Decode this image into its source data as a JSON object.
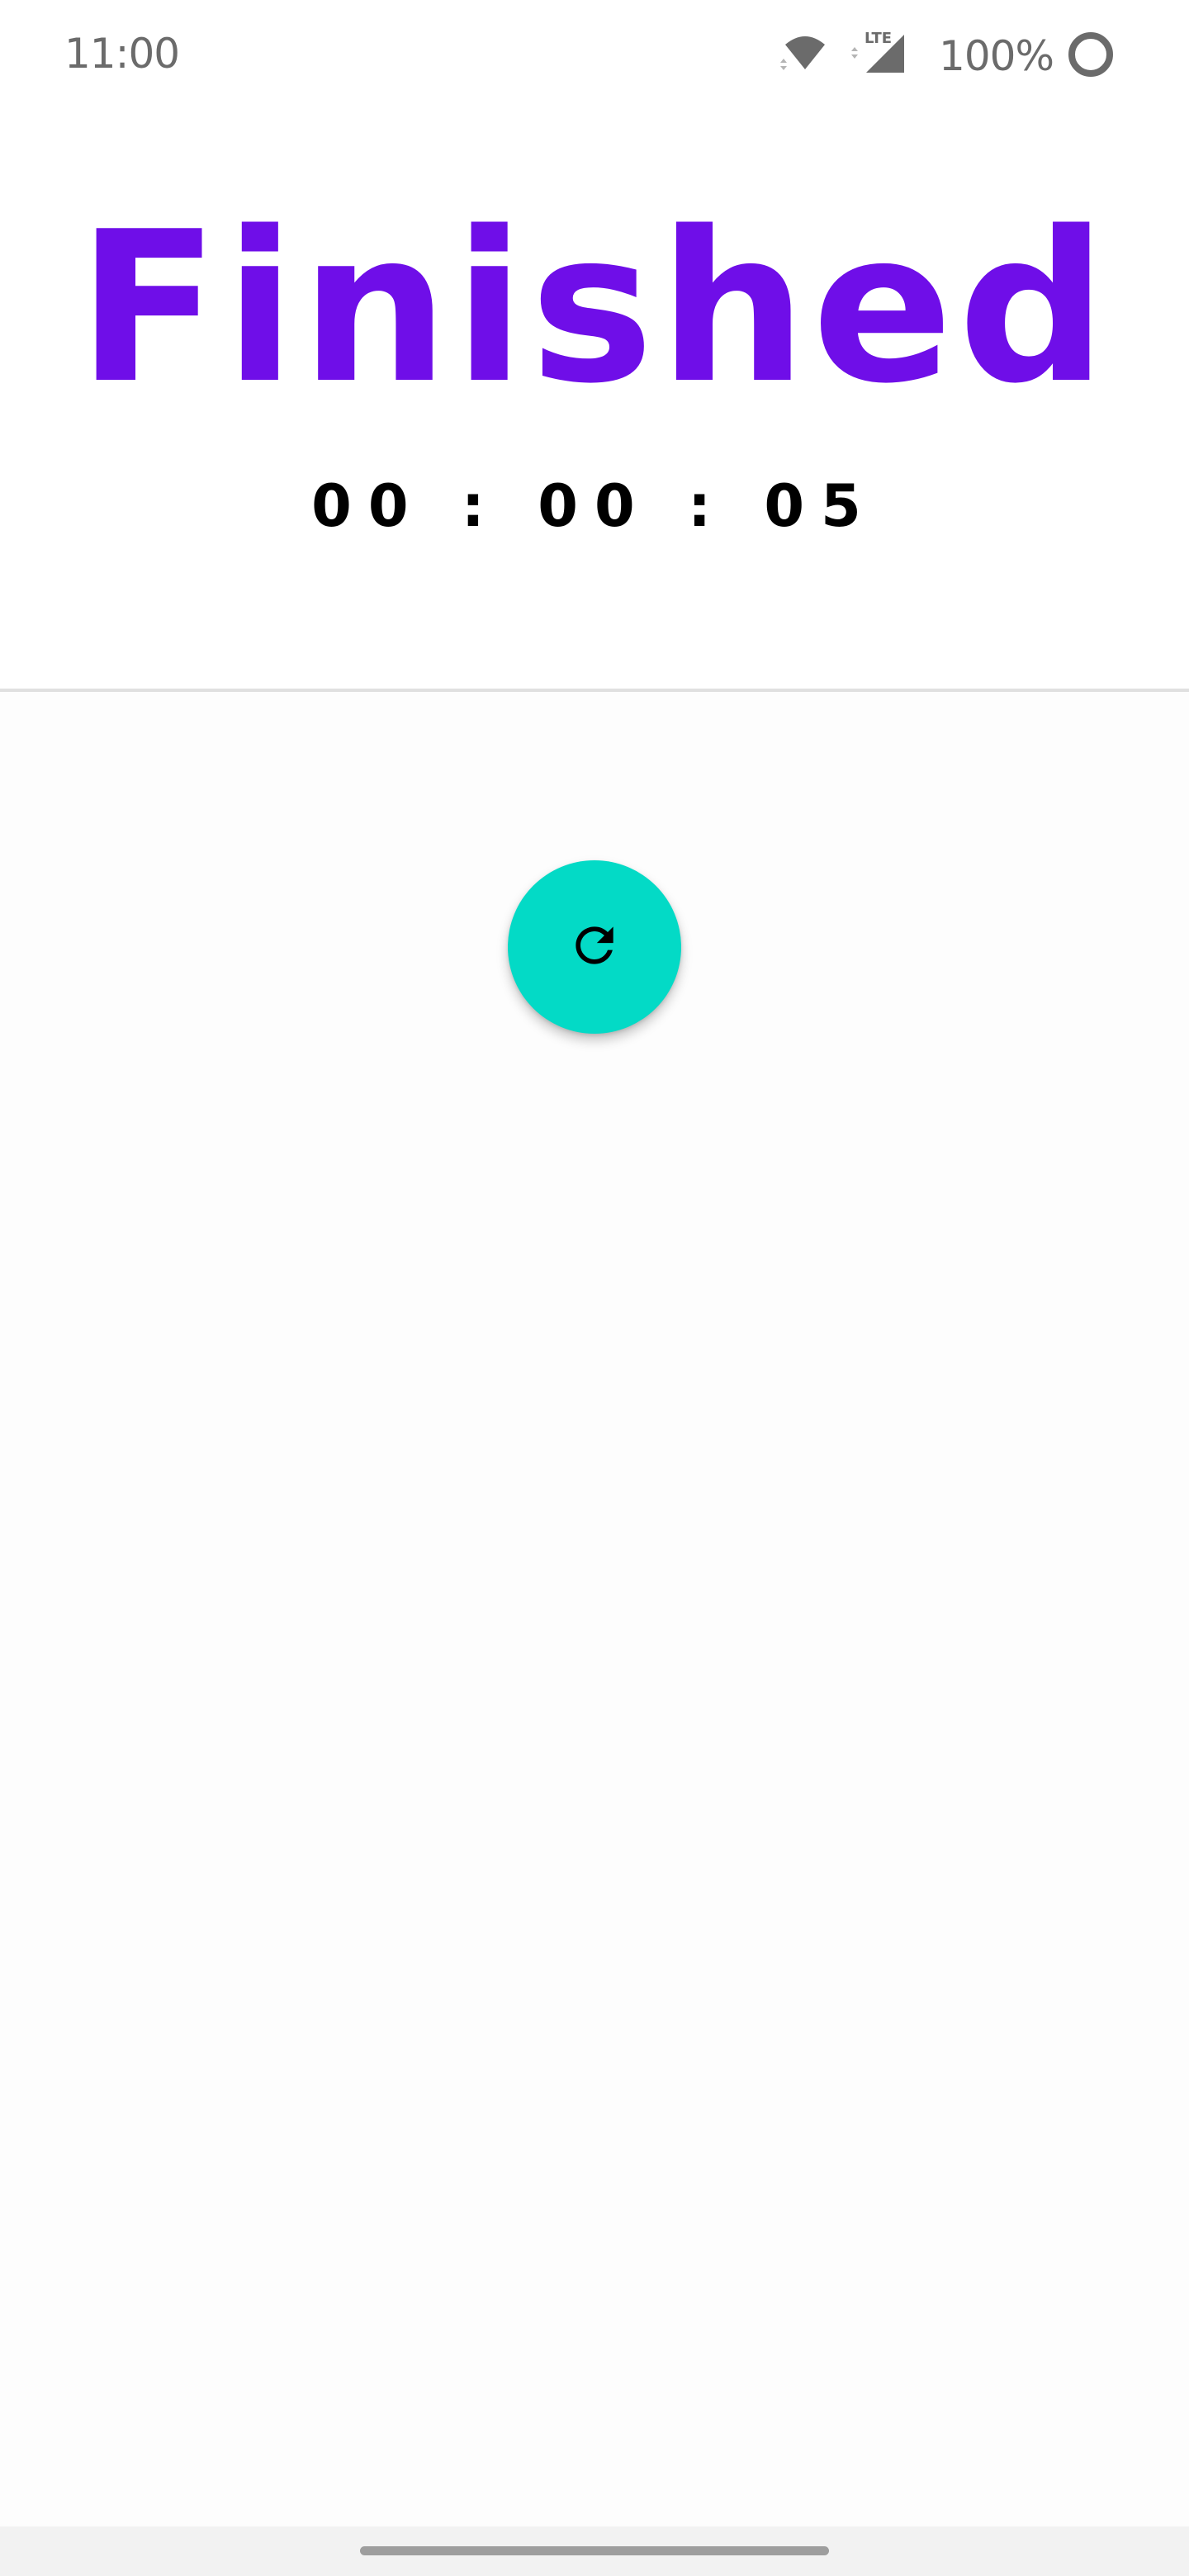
{
  "status_bar": {
    "time": "11:00",
    "network_label": "LTE",
    "battery": "100%",
    "icon_color": "#6b6b6b"
  },
  "stopwatch": {
    "title": "Finished",
    "elapsed": "00 : 00 : 05",
    "title_color": "#6f0ee8"
  },
  "fab": {
    "icon": "refresh-icon",
    "color": "#03dac6"
  }
}
